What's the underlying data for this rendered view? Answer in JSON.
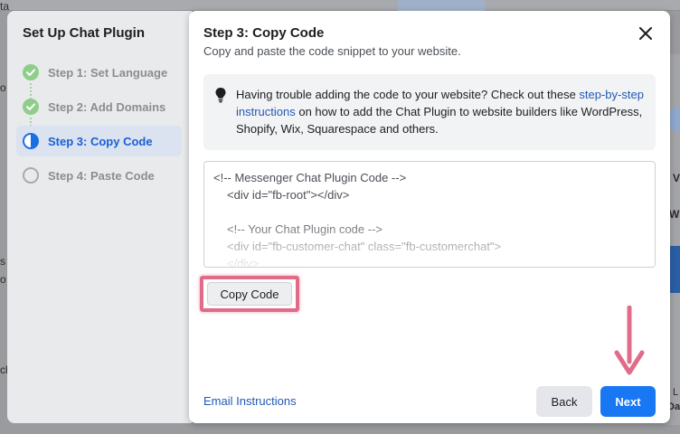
{
  "background": {
    "fragments": [
      "ta",
      "o",
      "s",
      "o",
      "ch",
      "V",
      "W",
      "L",
      "Da"
    ]
  },
  "steps_panel": {
    "title": "Set Up Chat Plugin",
    "steps": [
      {
        "label": "Step 1: Set Language",
        "state": "done"
      },
      {
        "label": "Step 2: Add Domains",
        "state": "done"
      },
      {
        "label": "Step 3: Copy Code",
        "state": "active"
      },
      {
        "label": "Step 4: Paste Code",
        "state": "todo"
      }
    ]
  },
  "dialog": {
    "title": "Step 3: Copy Code",
    "subtitle": "Copy and paste the code snippet to your website.",
    "info": {
      "icon": "lightbulb-icon",
      "text_before": "Having trouble adding the code to your website? Check out these ",
      "link": "step-by-step instructions",
      "text_after": " on how to add the Chat Plugin to website builders like WordPress, Shopify, Wix, Squarespace and others."
    },
    "code_lines": [
      "<!-- Messenger Chat Plugin Code -->",
      "<div id=\"fb-root\"></div>",
      "",
      "<!-- Your Chat Plugin code -->",
      "<div id=\"fb-customer-chat\" class=\"fb-customerchat\">",
      "</div>"
    ],
    "copy_button": "Copy Code",
    "email_link": "Email Instructions",
    "back_button": "Back",
    "next_button": "Next"
  },
  "colors": {
    "accent": "#1877f2",
    "link": "#2359b5",
    "highlight": "#e06c8a",
    "done": "#8fce8a"
  }
}
